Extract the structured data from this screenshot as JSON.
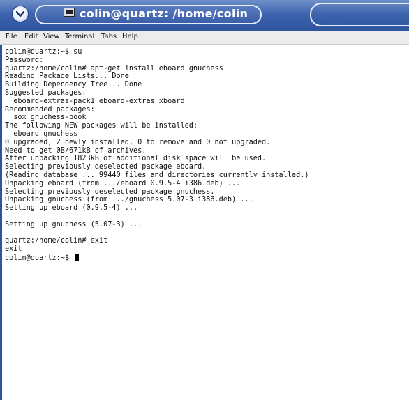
{
  "window": {
    "title": "colin@quartz: /home/colin"
  },
  "menu": {
    "file": "File",
    "edit": "Edit",
    "view": "View",
    "terminal": "Terminal",
    "tabs": "Tabs",
    "help": "Help"
  },
  "terminal": {
    "lines": [
      "colin@quartz:~$ su",
      "Password:",
      "quartz:/home/colin# apt-get install eboard gnuchess",
      "Reading Package Lists... Done",
      "Building Dependency Tree... Done",
      "Suggested packages:",
      "  eboard-extras-pack1 eboard-extras xboard",
      "Recommended packages:",
      "  sox gnuchess-book",
      "The following NEW packages will be installed:",
      "  eboard gnuchess",
      "0 upgraded, 2 newly installed, 0 to remove and 0 not upgraded.",
      "Need to get 0B/671kB of archives.",
      "After unpacking 1823kB of additional disk space will be used.",
      "Selecting previously deselected package eboard.",
      "(Reading database ... 99440 files and directories currently installed.)",
      "Unpacking eboard (from .../eboard_0.9.5-4_i386.deb) ...",
      "Selecting previously deselected package gnuchess.",
      "Unpacking gnuchess (from .../gnuchess_5.07-3_i386.deb) ...",
      "Setting up eboard (0.9.5-4) ...",
      "",
      "Setting up gnuchess (5.07-3) ...",
      "",
      "quartz:/home/colin# exit",
      "exit"
    ],
    "prompt": "colin@quartz:~$"
  }
}
